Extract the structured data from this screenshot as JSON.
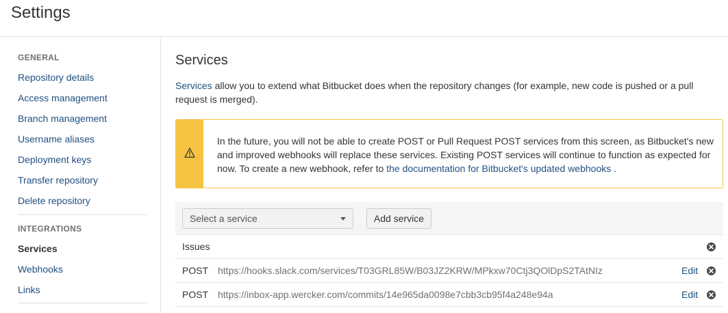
{
  "header": {
    "title": "Settings"
  },
  "sidebar": {
    "general_heading": "GENERAL",
    "general_items": [
      {
        "label": "Repository details"
      },
      {
        "label": "Access management"
      },
      {
        "label": "Branch management"
      },
      {
        "label": "Username aliases"
      },
      {
        "label": "Deployment keys"
      },
      {
        "label": "Transfer repository"
      },
      {
        "label": "Delete repository"
      }
    ],
    "integrations_heading": "INTEGRATIONS",
    "integrations_items": [
      {
        "label": "Services",
        "active": true
      },
      {
        "label": "Webhooks",
        "active": false
      },
      {
        "label": "Links",
        "active": false
      }
    ]
  },
  "main": {
    "title": "Services",
    "intro_link": "Services",
    "intro_text": " allow you to extend what Bitbucket does when the repository changes (for example, new code is pushed or a pull request is merged).",
    "warning": {
      "text_before": "In the future, you will not be able to create POST or Pull Request POST services from this screen, as Bitbucket's new and improved webhooks will replace these services. Existing POST services will continue to function as expected for now. To create a new webhook, refer to ",
      "link": "the documentation for Bitbucket's updated webhooks",
      "text_after": " .",
      "icon": "warning-icon",
      "color": "#f6c342"
    },
    "select_placeholder": "Select a service",
    "add_button": "Add service",
    "services": [
      {
        "type": "Issues",
        "url": "",
        "edit": ""
      },
      {
        "type": "POST",
        "url": "https://hooks.slack.com/services/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",
        "edit": "Edit"
      },
      {
        "type": "POST",
        "url": "https://inbox-app.wercker.com/commits/14e965da0098e7cbb3cb95f4a248e94a",
        "edit": "Edit"
      }
    ]
  },
  "colors": {
    "link": "#205081",
    "accent_warning": "#f6c342",
    "text": "#333333",
    "muted": "#707070"
  }
}
